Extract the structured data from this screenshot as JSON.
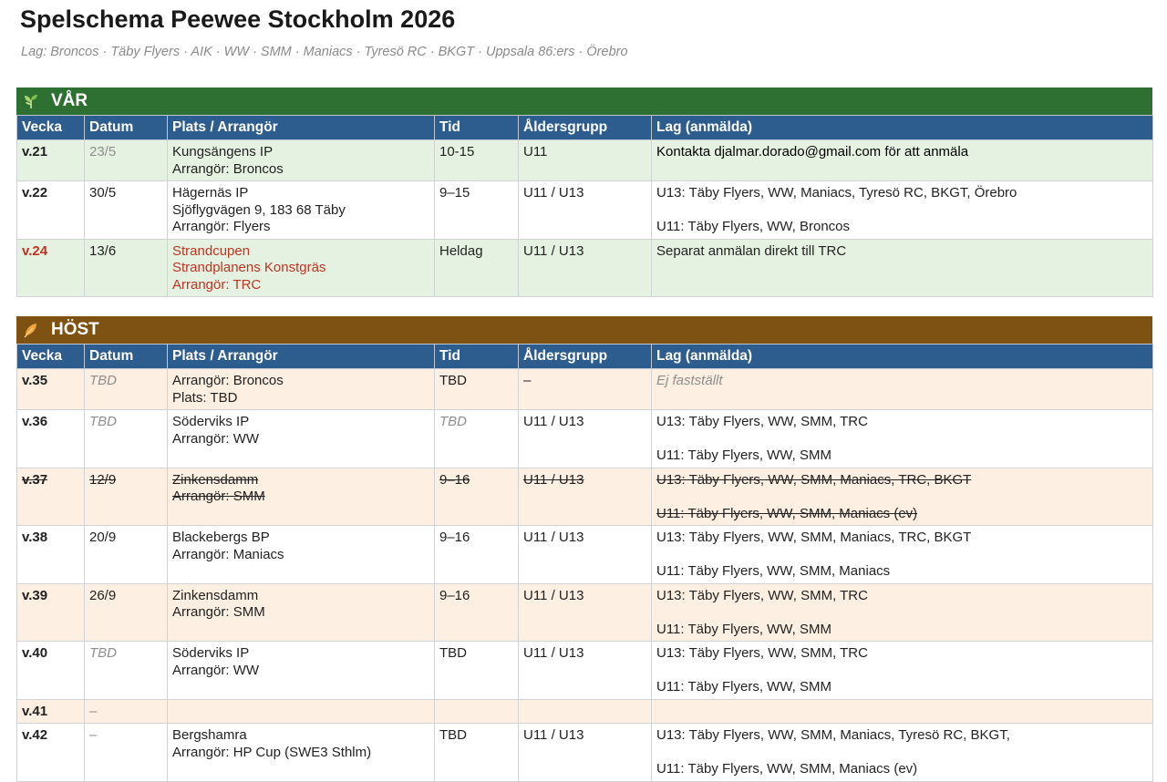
{
  "title": "Spelschema Peewee Stockholm 2026",
  "subtitle": "Lag: Broncos · Täby Flyers · AIK · WW · SMM · Maniacs · Tyresö RC · BKGT · Uppsala 86:ers · Örebro",
  "colors": {
    "spring_banner": "#2e7031",
    "autumn_banner": "#7d5212",
    "header": "#2d5d8f",
    "highlight_red": "#bf3322"
  },
  "headers": [
    "Vecka",
    "Datum",
    "Plats / Arrangör",
    "Tid",
    "Åldersgrupp",
    "Lag (anmälda)"
  ],
  "spring": {
    "label": "VÅR",
    "icon": "sprout-icon",
    "rows": [
      {
        "week": "v.21",
        "date": "23/5",
        "place": [
          "Kungsängens IP",
          "Arrangör: Broncos"
        ],
        "time": "10-15",
        "age": "U11",
        "teams": [
          "Kontakta djalmar.dorado@gmail.com för att anmäla"
        ]
      },
      {
        "week": "v.22",
        "date": "30/5",
        "place": [
          "Hägernäs IP",
          "Sjöflygvägen 9, 183 68 Täby",
          "Arrangör: Flyers"
        ],
        "time": "9–15",
        "age": "U11 / U13",
        "teams": [
          "U13: Täby Flyers, WW, Maniacs, Tyresö RC, BKGT, Örebro",
          "U11: Täby Flyers, WW, Broncos"
        ]
      },
      {
        "week": "v.24",
        "date": "13/6",
        "place": [
          "Strandcupen",
          "Strandplanens Konstgräs",
          "Arrangör: TRC"
        ],
        "time": "Heldag",
        "age": "U11 / U13",
        "teams": [
          "Separat anmälan direkt till TRC"
        ]
      }
    ]
  },
  "autumn": {
    "label": "HÖST",
    "icon": "leaf-icon",
    "rows": [
      {
        "week": "v.35",
        "date": "TBD",
        "place": [
          "Arrangör: Broncos",
          "Plats: TBD"
        ],
        "time": "TBD",
        "age": "–",
        "teams": [
          "Ej fastställt"
        ]
      },
      {
        "week": "v.36",
        "date": "TBD",
        "place": [
          "Söderviks IP",
          "Arrangör: WW"
        ],
        "time": "TBD",
        "age": "U11 / U13",
        "teams": [
          "U13: Täby Flyers, WW, SMM, TRC",
          "U11: Täby Flyers, WW, SMM"
        ]
      },
      {
        "week": "v.37",
        "date": "12/9",
        "place": [
          "Zinkensdamm",
          "Arrangör: SMM"
        ],
        "time": "9–16",
        "age": "U11 / U13",
        "teams": [
          "U13: Täby Flyers, WW, SMM, Maniacs, TRC, BKGT",
          "U11: Täby Flyers, WW, SMM, Maniacs (ev)"
        ]
      },
      {
        "week": "v.38",
        "date": "20/9",
        "place": [
          "Blackebergs BP",
          "Arrangör: Maniacs"
        ],
        "time": "9–16",
        "age": "U11 / U13",
        "teams": [
          "U13: Täby Flyers, WW, SMM, Maniacs, TRC, BKGT",
          "U11: Täby Flyers, WW, SMM, Maniacs"
        ]
      },
      {
        "week": "v.39",
        "date": "26/9",
        "place": [
          "Zinkensdamm",
          "Arrangör: SMM"
        ],
        "time": "9–16",
        "age": "U11 / U13",
        "teams": [
          "U13: Täby Flyers, WW, SMM, TRC",
          "U11: Täby Flyers, WW, SMM"
        ]
      },
      {
        "week": "v.40",
        "date": "TBD",
        "place": [
          "Söderviks IP",
          "Arrangör: WW"
        ],
        "time": "TBD",
        "age": "U11 / U13",
        "teams": [
          "U13: Täby Flyers, WW, SMM, TRC",
          "U11: Täby Flyers, WW, SMM"
        ]
      },
      {
        "week": "v.41",
        "date": "–"
      },
      {
        "week": "v.42",
        "date": "–",
        "place": [
          "Bergshamra",
          "Arrangör: HP Cup (SWE3 Sthlm)"
        ],
        "time": "TBD",
        "age": "U11 / U13",
        "teams": [
          "U13: Täby Flyers, WW, SMM, Maniacs, Tyresö RC, BKGT,",
          "U11: Täby Flyers, WW, SMM, Maniacs (ev)"
        ]
      }
    ]
  }
}
